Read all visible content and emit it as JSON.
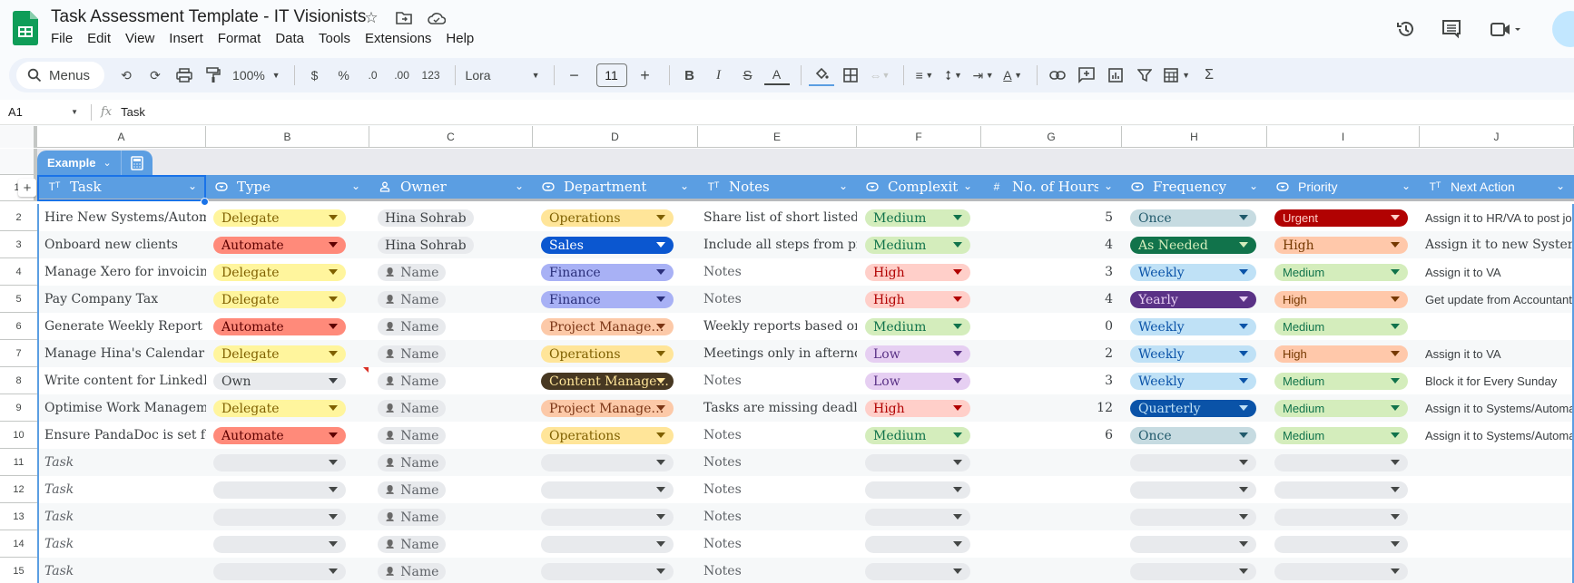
{
  "app": {
    "doc_title": "Task Assessment Template - IT Visionists",
    "menu": [
      "File",
      "Edit",
      "View",
      "Insert",
      "Format",
      "Data",
      "Tools",
      "Extensions",
      "Help"
    ],
    "title_icons": [
      "star-icon",
      "move-to-folder-icon",
      "cloud-saved-icon"
    ],
    "right_icons": [
      "version-history-icon",
      "comments-icon",
      "meet-icon"
    ]
  },
  "toolbar": {
    "search_label": "Menus",
    "zoom": "100%",
    "currency": "$",
    "percent": "%",
    "decrease_decimal": ".0",
    "increase_decimal": ".00",
    "number_format": "123",
    "font": "Lora",
    "font_size": "11",
    "bold": "B",
    "italic": "I",
    "text_color": "A",
    "sum": "Σ"
  },
  "formula_bar": {
    "cell_ref": "A1",
    "fx": "fx",
    "value": "Task"
  },
  "columns": [
    "A",
    "B",
    "C",
    "D",
    "E",
    "F",
    "G",
    "H",
    "I",
    "J"
  ],
  "table": {
    "name": "Example",
    "headers": [
      {
        "label": "Task",
        "icon": "text-type-icon"
      },
      {
        "label": "Type",
        "icon": "dropdown-type-icon"
      },
      {
        "label": "Owner",
        "icon": "person-type-icon"
      },
      {
        "label": "Department",
        "icon": "dropdown-type-icon"
      },
      {
        "label": "Notes",
        "icon": "text-type-icon"
      },
      {
        "label": "Complexity",
        "icon": "dropdown-type-icon"
      },
      {
        "label": "No. of Hours",
        "icon": "number-type-icon"
      },
      {
        "label": "Frequency",
        "icon": "dropdown-type-icon"
      },
      {
        "label": "Priority",
        "icon": "dropdown-type-icon"
      },
      {
        "label": "Next Action",
        "icon": "text-type-icon"
      }
    ],
    "rows": [
      {
        "n": "2",
        "task": "Hire New Systems/Automation",
        "type": "Delegate",
        "owner": "Hina Sohrab",
        "dept": "Operations",
        "notes": "Share list of short listed",
        "complexity": "Medium",
        "hours": "5",
        "frequency": "Once",
        "priority": "Urgent",
        "next": "Assign it to HR/VA to post job"
      },
      {
        "n": "3",
        "task": "Onboard new clients",
        "type": "Automate",
        "owner": "Hina Sohrab",
        "dept": "Sales",
        "notes": "Include all steps from pr",
        "complexity": "Medium",
        "hours": "4",
        "frequency": "As Needed",
        "priority": "High",
        "next": "Assign it to new Systems"
      },
      {
        "n": "4",
        "task": "Manage Xero for invoicing",
        "type": "Delegate",
        "owner": "",
        "dept": "Finance",
        "notes": "",
        "complexity": "High",
        "hours": "3",
        "frequency": "Weekly",
        "priority": "Medium",
        "next": "Assign it to VA"
      },
      {
        "n": "5",
        "task": "Pay Company Tax",
        "type": "Delegate",
        "owner": "",
        "dept": "Finance",
        "notes": "",
        "complexity": "High",
        "hours": "4",
        "frequency": "Yearly",
        "priority": "High",
        "next": "Get update from Accountant"
      },
      {
        "n": "6",
        "task": "Generate Weekly Report for",
        "type": "Automate",
        "owner": "",
        "dept": "Project Managem...",
        "notes": "Weekly reports based on",
        "complexity": "Medium",
        "hours": "0",
        "frequency": "Weekly",
        "priority": "Medium",
        "next": ""
      },
      {
        "n": "7",
        "task": "Manage Hina's Calendar",
        "type": "Delegate",
        "owner": "",
        "dept": "Operations",
        "notes": "Meetings only in afternoon",
        "complexity": "Low",
        "hours": "2",
        "frequency": "Weekly",
        "priority": "High",
        "next": "Assign it to VA"
      },
      {
        "n": "8",
        "task": "Write content for LinkedIn",
        "type": "Own",
        "owner": "",
        "dept": "Content Manage...",
        "notes": "",
        "complexity": "Low",
        "hours": "3",
        "frequency": "Weekly",
        "priority": "Medium",
        "next": "Block it for Every Sunday"
      },
      {
        "n": "9",
        "task": "Optimise Work Management",
        "type": "Delegate",
        "owner": "",
        "dept": "Project Managem...",
        "notes": "Tasks are missing deadlines",
        "complexity": "High",
        "hours": "12",
        "frequency": "Quarterly",
        "priority": "Medium",
        "next": "Assign it to Systems/Automation"
      },
      {
        "n": "10",
        "task": "Ensure PandaDoc is set for",
        "type": "Automate",
        "owner": "",
        "dept": "Operations",
        "notes": "",
        "complexity": "Medium",
        "hours": "6",
        "frequency": "Once",
        "priority": "Medium",
        "next": "Assign it to Systems/Automation"
      },
      {
        "n": "11",
        "task": "",
        "type": "",
        "owner": "",
        "dept": "",
        "notes": "",
        "complexity": "",
        "hours": "",
        "frequency": "",
        "priority": "",
        "next": ""
      },
      {
        "n": "12",
        "task": "",
        "type": "",
        "owner": "",
        "dept": "",
        "notes": "",
        "complexity": "",
        "hours": "",
        "frequency": "",
        "priority": "",
        "next": ""
      },
      {
        "n": "13",
        "task": "",
        "type": "",
        "owner": "",
        "dept": "",
        "notes": "",
        "complexity": "",
        "hours": "",
        "frequency": "",
        "priority": "",
        "next": ""
      },
      {
        "n": "14",
        "task": "",
        "type": "",
        "owner": "",
        "dept": "",
        "notes": "",
        "complexity": "",
        "hours": "",
        "frequency": "",
        "priority": "",
        "next": ""
      },
      {
        "n": "15",
        "task": "",
        "type": "",
        "owner": "",
        "dept": "",
        "notes": "",
        "complexity": "",
        "hours": "",
        "frequency": "",
        "priority": "",
        "next": ""
      }
    ],
    "placeholders": {
      "task": "Task",
      "owner": "Name",
      "notes": "Notes"
    },
    "row1_label": "1"
  },
  "chip_colors": {
    "Delegate": {
      "bg": "#fff59d",
      "fg": "#7f6000"
    },
    "Automate": {
      "bg": "#ff8a7a",
      "fg": "#5e0000"
    },
    "Own": {
      "bg": "#e8eaed",
      "fg": "#3c4043"
    },
    "Operations": {
      "bg": "#ffe599",
      "fg": "#7f6000"
    },
    "Sales": {
      "bg": "#0b57d0",
      "fg": "#ffffff"
    },
    "Finance": {
      "bg": "#a8b1f5",
      "fg": "#2a2f7a"
    },
    "Project Managem...": {
      "bg": "#fcc9a8",
      "fg": "#7a3414"
    },
    "Content Manage...": {
      "bg": "#473822",
      "fg": "#ffe599"
    },
    "Medium": {
      "bg": "#d4edbc",
      "fg": "#11734b"
    },
    "High": {
      "bg": "#ffcfc9",
      "fg": "#b10202"
    },
    "Low": {
      "bg": "#e6cff2",
      "fg": "#5a3286"
    },
    "Once": {
      "bg": "#c6dbe1",
      "fg": "#215a6c"
    },
    "As Needed": {
      "bg": "#11734b",
      "fg": "#d4edbc"
    },
    "Weekly": {
      "bg": "#bfe1f6",
      "fg": "#0a53a8"
    },
    "Yearly": {
      "bg": "#5a3286",
      "fg": "#e6cff2"
    },
    "Quarterly": {
      "bg": "#0a53a8",
      "fg": "#bfe1f6"
    },
    "Urgent": {
      "bg": "#b10202",
      "fg": "#ffcfc9"
    },
    "PriorityHigh": {
      "bg": "#ffc8aa",
      "fg": "#753800"
    },
    "PriorityMedium": {
      "bg": "#d4edbc",
      "fg": "#11734b"
    },
    "Empty": {
      "bg": "#e8eaed",
      "fg": "#5f6368"
    }
  },
  "accent": "#5b9ee2"
}
